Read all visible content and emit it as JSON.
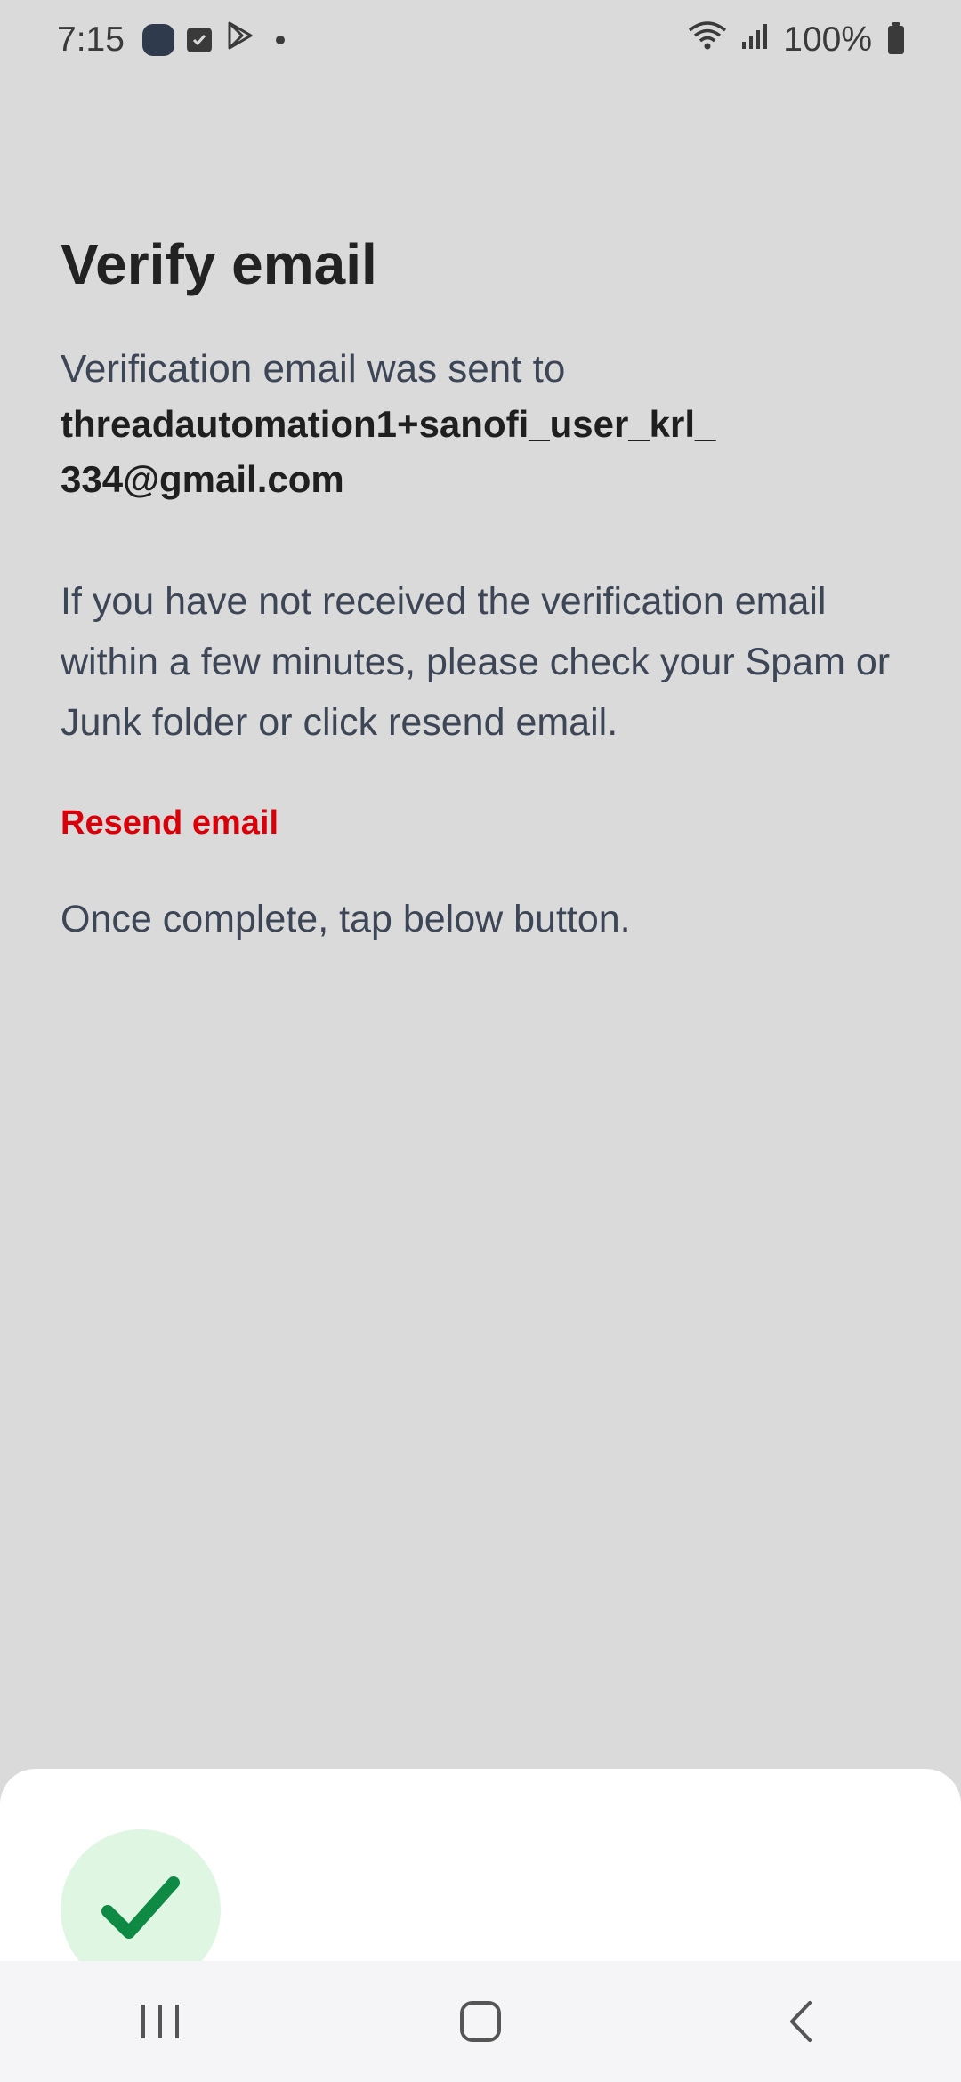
{
  "status_bar": {
    "time": "7:15",
    "battery_text": "100%",
    "icons": [
      "app-icon",
      "checkbox-icon",
      "play-store-icon",
      "notification-dot-icon",
      "wifi-icon",
      "signal-icon",
      "battery-icon"
    ]
  },
  "main": {
    "title": "Verify email",
    "sent_label": "Verification email was sent to",
    "email": "threadautomation1+sanofi_user_krl_334@gmail.com",
    "instructions": "If you have not received the verification email within a few minutes, please check your Spam or Junk folder or click resend email.",
    "resend_label": "Resend email",
    "once_complete": "Once complete, tap below button."
  },
  "bottom_sheet": {
    "confirm_icon": "checkmark-icon"
  },
  "nav_bar": {
    "icons": [
      "recent-apps-icon",
      "home-icon",
      "back-icon"
    ]
  },
  "colors": {
    "background": "#dadada",
    "accent_red": "#d9000a",
    "confirm_green": "#0f8a45",
    "confirm_bg": "#dff6e3",
    "body_text": "#3d4656"
  }
}
